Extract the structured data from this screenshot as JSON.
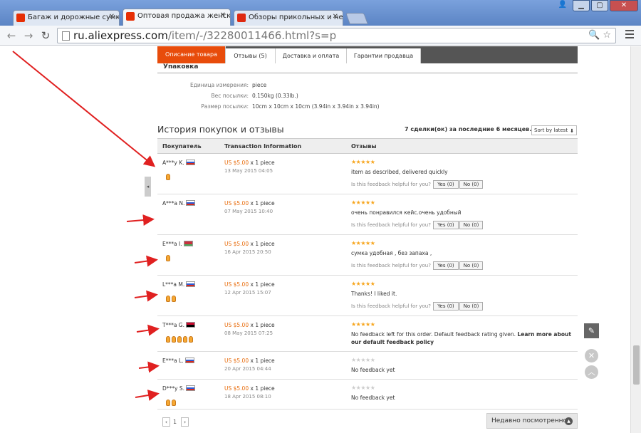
{
  "browser": {
    "tabs": [
      {
        "title": "Багаж и дорожные сумки К"
      },
      {
        "title": "Оптовая продажа женский"
      },
      {
        "title": "Обзоры прикольных и необ"
      }
    ],
    "url_host": "ru.aliexpress.com",
    "url_path": "/item/-/32280011466.html?s=p"
  },
  "product_tabs": [
    "Описание товара",
    "Отзывы (5)",
    "Доставка и оплата",
    "Гарантии продавца"
  ],
  "packaging": {
    "heading": "Упаковка",
    "specs": [
      {
        "key": "Единица измерения:",
        "value": "piece"
      },
      {
        "key": "Вес посылки:",
        "value": "0.150kg (0.33lb.)"
      },
      {
        "key": "Размер посылки:",
        "value": "10cm x 10cm x 10cm (3.94in x 3.94in x 3.94in)"
      }
    ]
  },
  "history": {
    "title": "История покупок и отзывы",
    "count": "7 сделки(ок) за последние 6 месяцев.",
    "sort": "Sort by latest",
    "columns": [
      "Покупатель",
      "Transaction Information",
      "Отзывы"
    ],
    "helpful_prompt": "Is this feedback helpful for you?",
    "yes": "Yes (0)",
    "no": "No (0)",
    "rows": [
      {
        "buyer": "A***y K.",
        "price": "US $5.00",
        "qty": "x 1 piece",
        "date": "13 May 2015 04:05",
        "feedback": "item as described, delivered quickly"
      },
      {
        "buyer": "A***a N.",
        "price": "US $5.00",
        "qty": "x 1 piece",
        "date": "07 May 2015 10:40",
        "feedback": "очень понравился кейс.очень удобный"
      },
      {
        "buyer": "E***a I.",
        "price": "US $5.00",
        "qty": "x 1 piece",
        "date": "16 Apr 2015 20:50",
        "feedback": "сумка удобная , без запаха ,"
      },
      {
        "buyer": "L***a M.",
        "price": "US $5.00",
        "qty": "x 1 piece",
        "date": "12 Apr 2015 15:07",
        "feedback": "Thanks! I liked it."
      },
      {
        "buyer": "T***a G.",
        "price": "US $5.00",
        "qty": "x 1 piece",
        "date": "08 May 2015 07:25",
        "feedback": "No feedback left for this order. Default feedback rating given.",
        "feedback_link": "Learn more about our default feedback policy"
      },
      {
        "buyer": "E***a L.",
        "price": "US $5.00",
        "qty": "x 1 piece",
        "date": "20 Apr 2015 04:44",
        "feedback": "No feedback yet"
      },
      {
        "buyer": "D***y S.",
        "price": "US $5.00",
        "qty": "x 1 piece",
        "date": "18 Apr 2015 08:10",
        "feedback": "No feedback yet"
      }
    ]
  },
  "pager": {
    "page": "1"
  },
  "recent": "Недавно посмотренное",
  "colors": {
    "accent": "#e84c0b",
    "price": "#e86c0c",
    "star": "#f7a51c",
    "annotation_arrow": "#e02020"
  }
}
